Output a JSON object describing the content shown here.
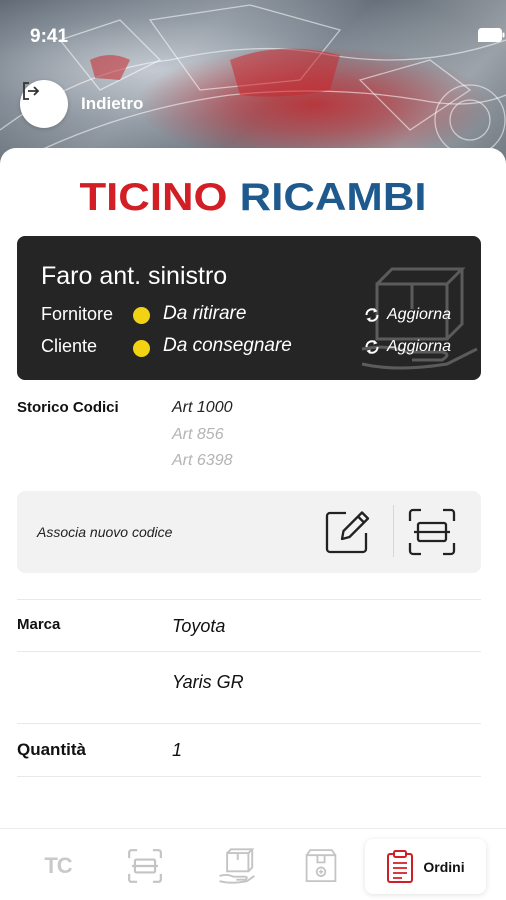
{
  "status_bar": {
    "time": "9:41"
  },
  "header": {
    "back_label": "Indietro"
  },
  "brand": {
    "word1": "TICINO",
    "word2": "RICAMBI",
    "red": "#d21f26",
    "blue": "#1e5a8e"
  },
  "part": {
    "title": "Faro ant. sinistro",
    "rows": [
      {
        "label": "Fornitore",
        "status": "Da ritirare",
        "action": "Aggiorna"
      },
      {
        "label": "Cliente",
        "status": "Da consegnare",
        "action": "Aggiorna"
      }
    ],
    "status_color": "#f2d313"
  },
  "history": {
    "label": "Storico Codici",
    "codes": [
      "Art 1000",
      "Art 856",
      "Art 6398"
    ]
  },
  "associate": {
    "text": "Associa nuovo codice",
    "edit_icon": "edit-icon",
    "scan_icon": "scan-icon"
  },
  "details": {
    "brand_label": "Marca",
    "brand_value": "Toyota",
    "model_value": "Yaris GR",
    "quantity_label": "Quantità",
    "quantity_value": "1"
  },
  "nav": {
    "tc_label": "TC",
    "active_label": "Ordini",
    "items": [
      "tc-logo-icon",
      "scan-icon",
      "box-hand-icon",
      "box-add-icon",
      "clipboard-icon"
    ]
  }
}
